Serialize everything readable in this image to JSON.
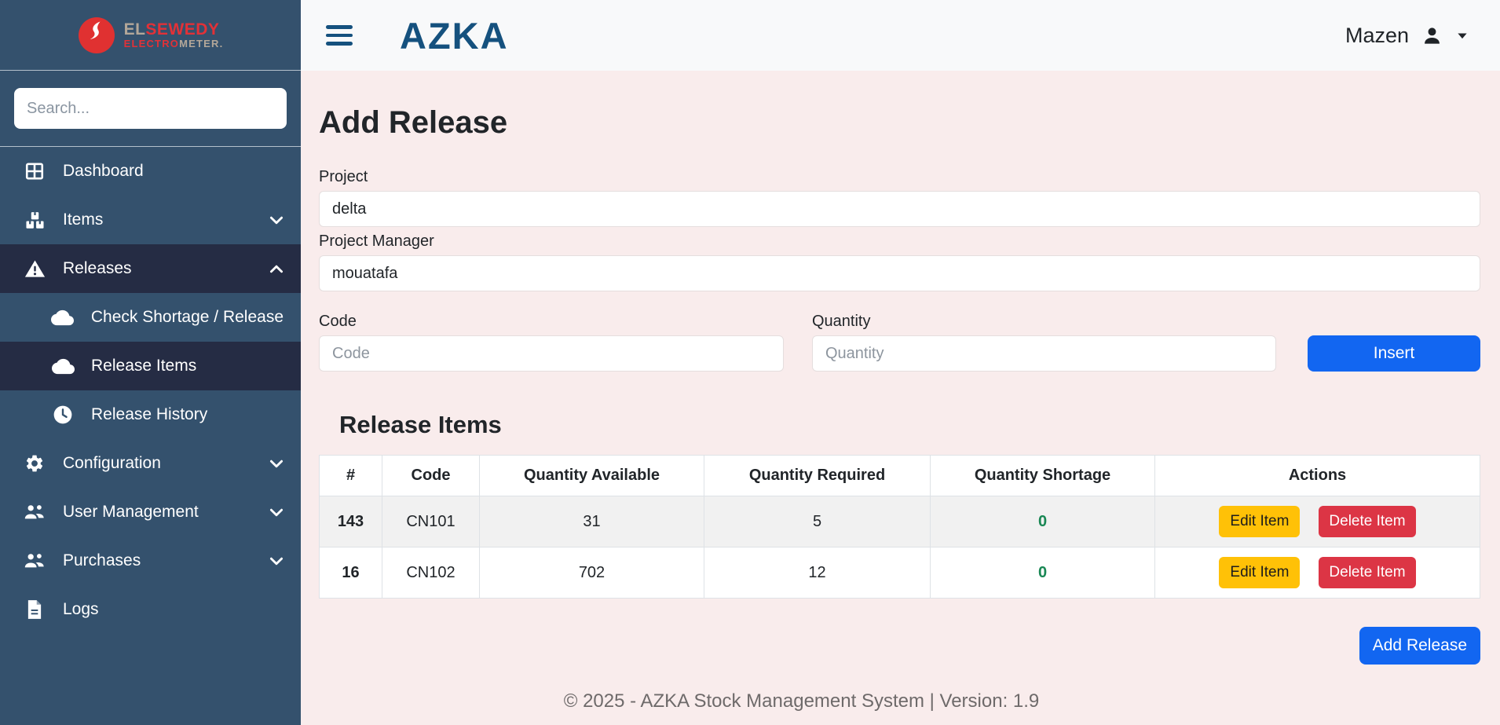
{
  "colors": {
    "sidebar_bg": "#34516d",
    "sidebar_active_bg": "#252c44",
    "content_bg": "#f9ecec",
    "topbar_bg": "#f8f9fa",
    "primary_blue": "#1266f1",
    "azka_blue": "#15517e",
    "logo_red": "#e23137",
    "logo_gray": "#b3a799",
    "edit_yellow": "#ffc107",
    "delete_red": "#dc3545",
    "shortage_green": "#198754"
  },
  "brand": {
    "logo": {
      "top_gray": "EL",
      "top_red": "SEWEDY",
      "bottom_red": "ELECTRO",
      "bottom_gray": "METER"
    },
    "app_logo": "AZKA"
  },
  "sidebar": {
    "search_placeholder": "Search...",
    "items": [
      {
        "label": "Dashboard",
        "icon": "dashboard-grid",
        "chevron": null,
        "active": false,
        "sub": false
      },
      {
        "label": "Items",
        "icon": "boxes",
        "chevron": "down",
        "active": false,
        "sub": false
      },
      {
        "label": "Releases",
        "icon": "warning-triangle",
        "chevron": "up",
        "active": true,
        "sub": false
      },
      {
        "label": "Check Shortage / Release",
        "icon": "cloud",
        "chevron": null,
        "active": false,
        "sub": true
      },
      {
        "label": "Release Items",
        "icon": "cloud",
        "chevron": null,
        "active": true,
        "sub": true
      },
      {
        "label": "Release History",
        "icon": "clock",
        "chevron": null,
        "active": false,
        "sub": true
      },
      {
        "label": "Configuration",
        "icon": "gear",
        "chevron": "down",
        "active": false,
        "sub": false
      },
      {
        "label": "User Management",
        "icon": "users",
        "chevron": "down",
        "active": false,
        "sub": false
      },
      {
        "label": "Purchases",
        "icon": "users",
        "chevron": "down",
        "active": false,
        "sub": false
      },
      {
        "label": "Logs",
        "icon": "file",
        "chevron": null,
        "active": false,
        "sub": false
      }
    ]
  },
  "header": {
    "user_name": "Mazen"
  },
  "main": {
    "title": "Add Release",
    "form": {
      "project_label": "Project",
      "project_value": "delta",
      "pm_label": "Project Manager",
      "pm_value": "mouatafa",
      "code_label": "Code",
      "code_placeholder": "Code",
      "quantity_label": "Quantity",
      "quantity_placeholder": "Quantity",
      "insert_label": "Insert"
    },
    "table": {
      "title": "Release Items",
      "headers": [
        "#",
        "Code",
        "Quantity Available",
        "Quantity Required",
        "Quantity Shortage",
        "Actions"
      ],
      "rows": [
        {
          "id": "143",
          "code": "CN101",
          "available": "31",
          "required": "5",
          "shortage": "0"
        },
        {
          "id": "16",
          "code": "CN102",
          "available": "702",
          "required": "12",
          "shortage": "0"
        }
      ],
      "edit_label": "Edit Item",
      "delete_label": "Delete Item"
    },
    "add_release_label": "Add Release",
    "footer": "© 2025 - AZKA Stock Management System | Version: 1.9"
  }
}
